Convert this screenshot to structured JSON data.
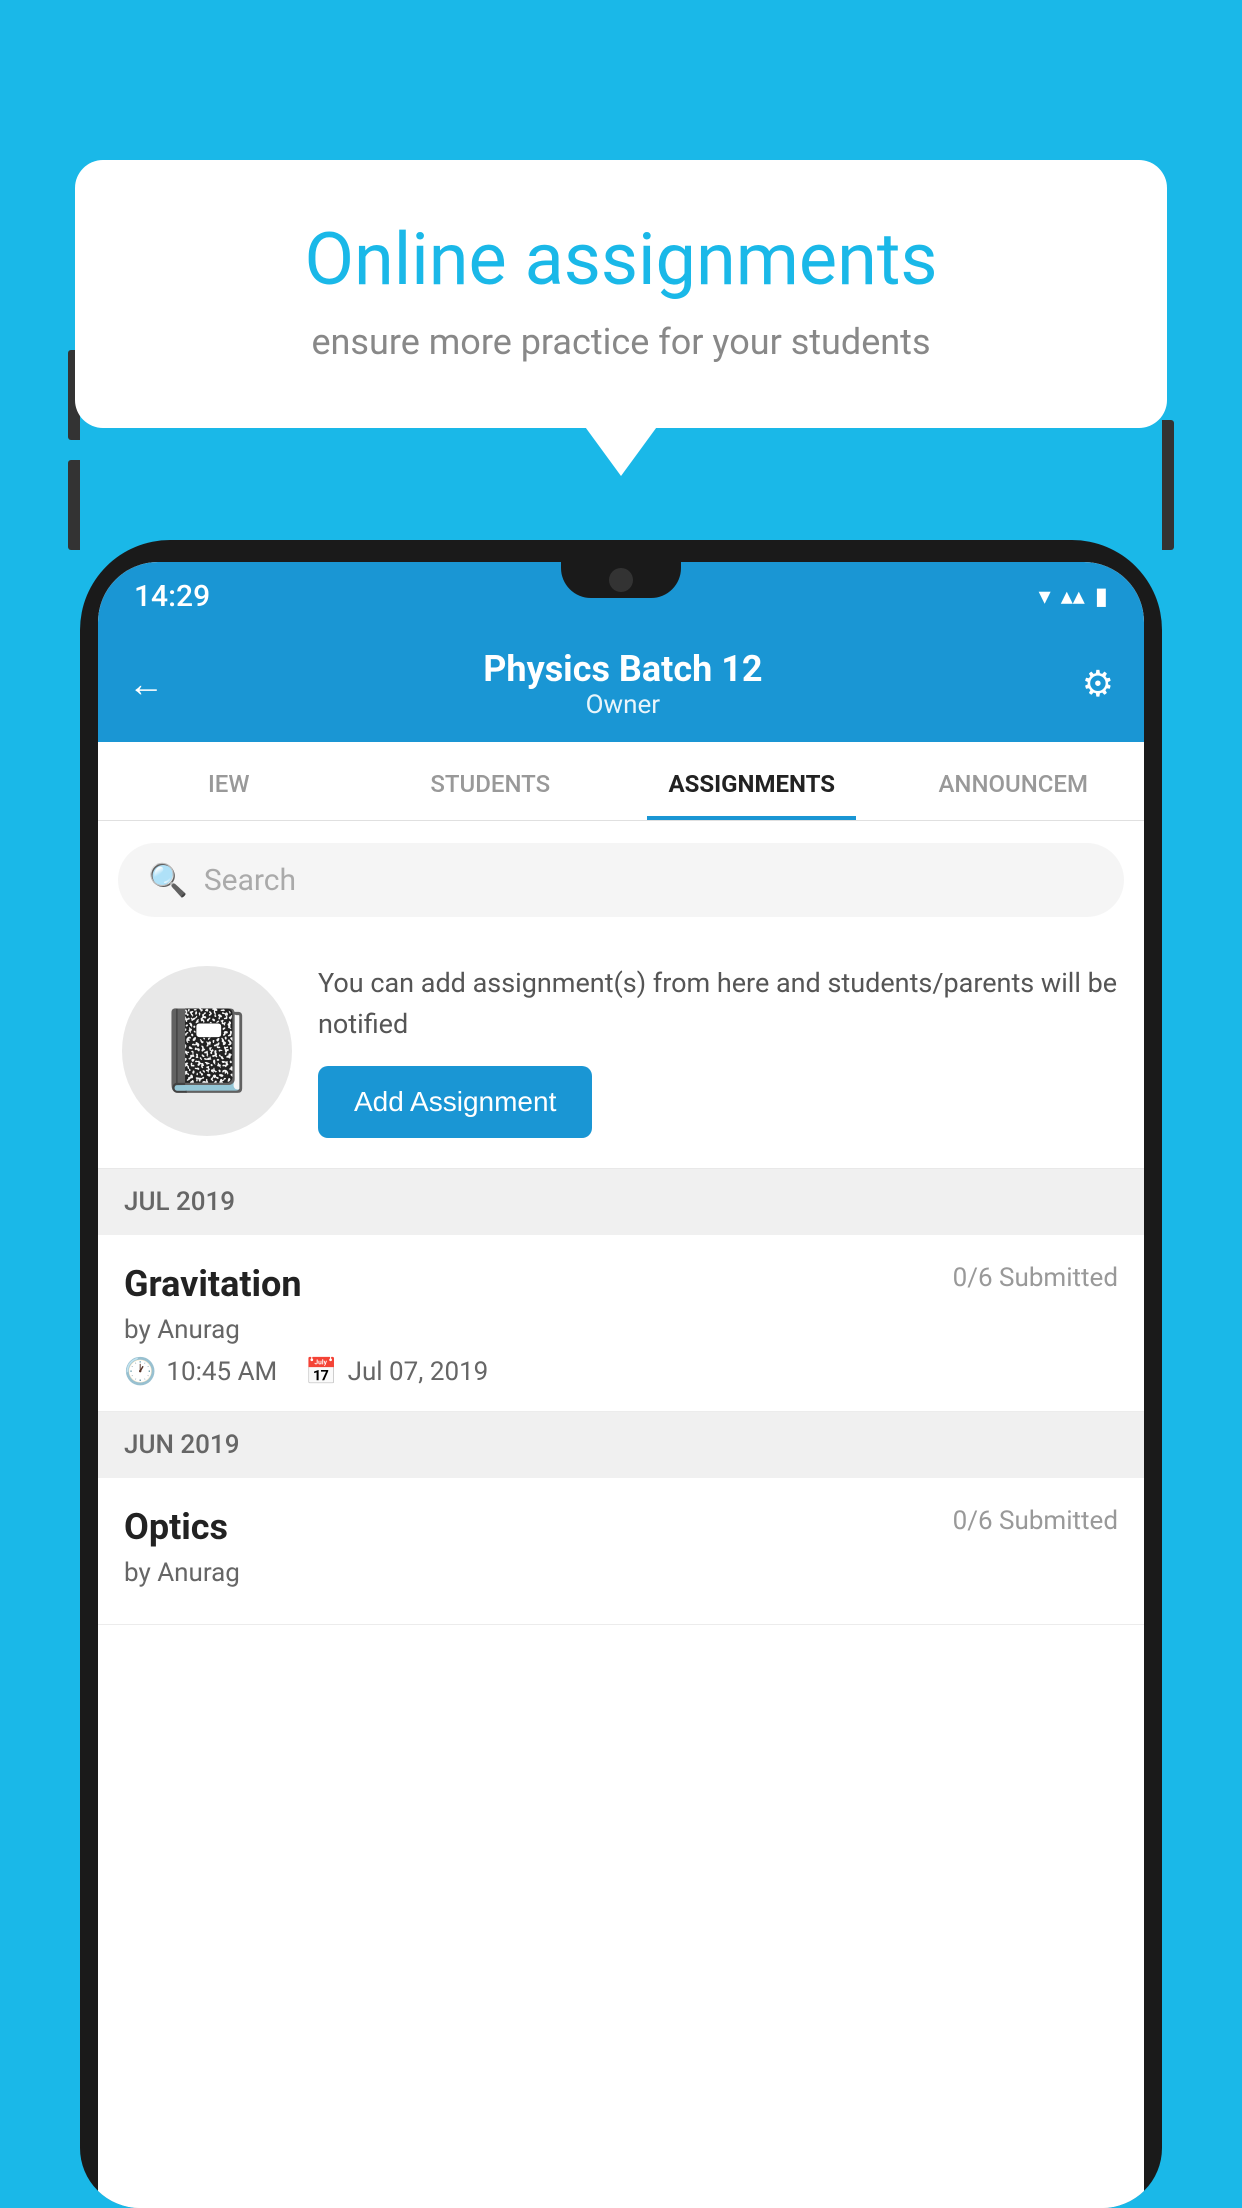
{
  "background_color": "#1ab8e8",
  "speech_bubble": {
    "title": "Online assignments",
    "subtitle": "ensure more practice for your students"
  },
  "status_bar": {
    "time": "14:29",
    "wifi_icon": "▼",
    "signal_icon": "▲",
    "battery_icon": "▮"
  },
  "header": {
    "title": "Physics Batch 12",
    "subtitle": "Owner",
    "back_icon": "←",
    "settings_icon": "⚙"
  },
  "tabs": [
    {
      "label": "IEW",
      "active": false
    },
    {
      "label": "STUDENTS",
      "active": false
    },
    {
      "label": "ASSIGNMENTS",
      "active": true
    },
    {
      "label": "ANNOUNCEM",
      "active": false
    }
  ],
  "search": {
    "placeholder": "Search"
  },
  "add_assignment": {
    "description": "You can add assignment(s) from here and students/parents will be notified",
    "button_label": "Add Assignment"
  },
  "months": [
    {
      "label": "JUL 2019",
      "assignments": [
        {
          "name": "Gravitation",
          "submitted": "0/6 Submitted",
          "by": "by Anurag",
          "time": "10:45 AM",
          "date": "Jul 07, 2019"
        }
      ]
    },
    {
      "label": "JUN 2019",
      "assignments": [
        {
          "name": "Optics",
          "submitted": "0/6 Submitted",
          "by": "by Anurag",
          "time": "",
          "date": ""
        }
      ]
    }
  ]
}
